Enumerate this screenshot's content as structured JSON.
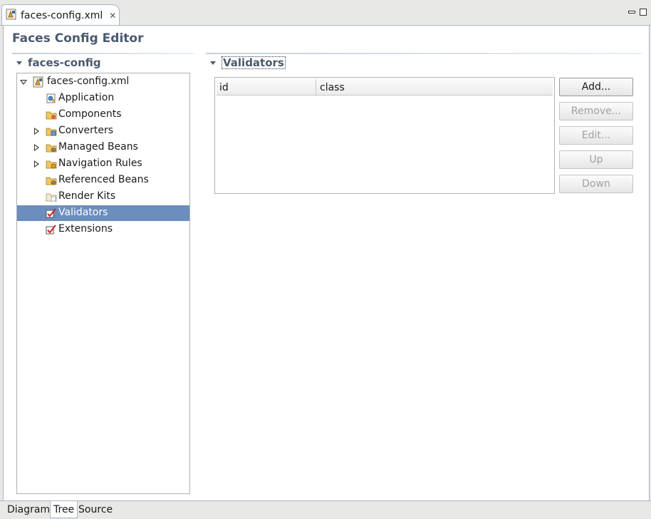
{
  "editor_tab": {
    "title": "faces-config.xml"
  },
  "form_title": "Faces Config Editor",
  "left_section": {
    "title": "faces-config"
  },
  "right_section": {
    "title": "Validators"
  },
  "tree": {
    "root": "faces-config.xml",
    "items": [
      {
        "label": "Application",
        "icon": "application-icon",
        "expandable": false
      },
      {
        "label": "Components",
        "icon": "components-folder-icon",
        "expandable": false
      },
      {
        "label": "Converters",
        "icon": "converters-folder-icon",
        "expandable": true
      },
      {
        "label": "Managed Beans",
        "icon": "beans-folder-icon",
        "expandable": true
      },
      {
        "label": "Navigation Rules",
        "icon": "navigation-folder-icon",
        "expandable": true
      },
      {
        "label": "Referenced Beans",
        "icon": "beans-folder-icon",
        "expandable": false
      },
      {
        "label": "Render Kits",
        "icon": "renderkits-folder-icon",
        "expandable": false
      },
      {
        "label": "Validators",
        "icon": "checkmark-icon",
        "expandable": false,
        "selected": true
      },
      {
        "label": "Extensions",
        "icon": "checkmark-icon",
        "expandable": false
      }
    ]
  },
  "table": {
    "columns": [
      "id",
      "class"
    ],
    "rows": []
  },
  "buttons": {
    "add": {
      "label": "Add...",
      "enabled": true
    },
    "remove": {
      "label": "Remove...",
      "enabled": false
    },
    "edit": {
      "label": "Edit...",
      "enabled": false
    },
    "up": {
      "label": "Up",
      "enabled": false
    },
    "down": {
      "label": "Down",
      "enabled": false
    }
  },
  "page_tabs": [
    {
      "label": "Diagram",
      "active": false
    },
    {
      "label": "Tree",
      "active": true
    },
    {
      "label": "Source",
      "active": false
    }
  ],
  "colors": {
    "selection": "#6b8ebf",
    "section_title": "#4a5a6e",
    "border": "#a8b4c4"
  }
}
